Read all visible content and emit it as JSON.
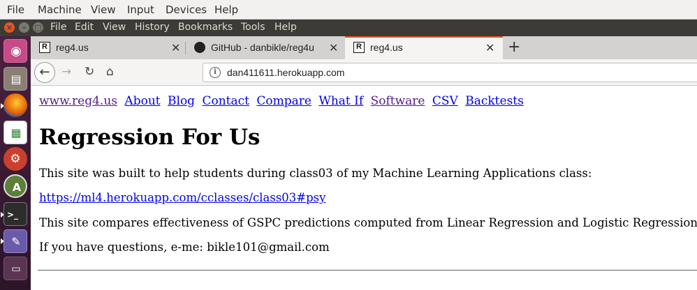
{
  "vm_menu": {
    "items": [
      "File",
      "Machine",
      "View",
      "Input",
      "Devices",
      "Help"
    ]
  },
  "firefox_menu": {
    "items": [
      "File",
      "Edit",
      "View",
      "History",
      "Bookmarks",
      "Tools",
      "Help"
    ]
  },
  "launcher": {
    "icons": [
      "ubuntu-dash-icon",
      "files-icon",
      "firefox-icon",
      "spreadsheet-icon",
      "settings-icon",
      "software-updater-icon",
      "terminal-icon",
      "text-editor-icon",
      "workspace-icon"
    ]
  },
  "tabs": [
    {
      "title": "reg4.us",
      "favicon": "R",
      "active": false
    },
    {
      "title": "GitHub - danbikle/reg4u",
      "favicon": "github",
      "active": false
    },
    {
      "title": "reg4.us",
      "favicon": "R",
      "active": true
    }
  ],
  "navbar": {
    "url": "dan411611.herokuapp.com"
  },
  "page": {
    "nav_links": [
      {
        "label": "www.reg4.us",
        "visited": true
      },
      {
        "label": "About",
        "visited": false
      },
      {
        "label": "Blog",
        "visited": false
      },
      {
        "label": "Contact",
        "visited": false
      },
      {
        "label": "Compare",
        "visited": false
      },
      {
        "label": "What If",
        "visited": false
      },
      {
        "label": "Software",
        "visited": true
      },
      {
        "label": "CSV",
        "visited": false
      },
      {
        "label": "Backtests",
        "visited": false
      }
    ],
    "heading": "Regression For Us",
    "para1": "This site was built to help students during class03 of my Machine Learning Applications class:",
    "link1": "https://ml4.herokuapp.com/cclasses/class03#psy",
    "para2": "This site compares effectiveness of GSPC predictions computed from Linear Regression and Logistic Regression.",
    "para3": "If you have questions, e-me: bikle101@gmail.com"
  },
  "colors": {
    "accent": "#e9541f",
    "link": "#0000ee",
    "visited": "#551a8b"
  }
}
